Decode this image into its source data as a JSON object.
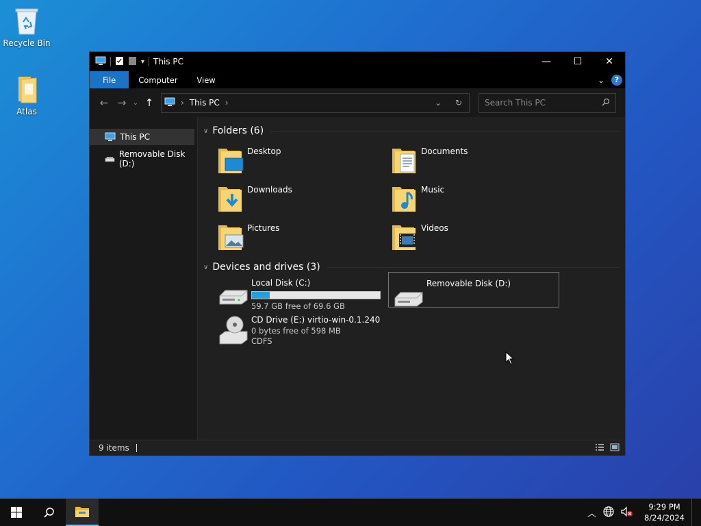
{
  "desktop": {
    "icons": [
      {
        "label": "Recycle Bin",
        "icon": "recycle-bin-icon"
      },
      {
        "label": "Atlas",
        "icon": "folder-icon"
      }
    ]
  },
  "window": {
    "title": "This PC",
    "controls": {
      "minimize": "—",
      "maximize": "☐",
      "close": "✕"
    },
    "ribbon": {
      "tabs": [
        "File",
        "Computer",
        "View"
      ],
      "help": "?"
    },
    "address": {
      "crumb": "This PC"
    },
    "search": {
      "placeholder": "Search This PC"
    },
    "sidebar": [
      {
        "label": "This PC",
        "icon": "computer-icon",
        "selected": true
      },
      {
        "label": "Removable Disk (D:)",
        "icon": "usb-drive-icon",
        "selected": false
      }
    ],
    "groups": {
      "folders": {
        "title": "Folders (6)"
      },
      "devices": {
        "title": "Devices and drives (3)"
      }
    },
    "folders": [
      {
        "name": "Desktop",
        "icon": "desktop-folder-icon"
      },
      {
        "name": "Documents",
        "icon": "documents-folder-icon"
      },
      {
        "name": "Downloads",
        "icon": "downloads-folder-icon"
      },
      {
        "name": "Music",
        "icon": "music-folder-icon"
      },
      {
        "name": "Pictures",
        "icon": "pictures-folder-icon"
      },
      {
        "name": "Videos",
        "icon": "videos-folder-icon"
      }
    ],
    "drives": [
      {
        "name": "Local Disk (C:)",
        "free": "59.7 GB free of 69.6 GB",
        "used_fraction": 0.14,
        "icon": "hard-drive-icon"
      },
      {
        "name": "CD Drive (E:) virtio-win-0.1.240",
        "free": "0 bytes free of 598 MB",
        "fs": "CDFS",
        "icon": "cd-drive-icon"
      },
      {
        "name": "Removable Disk (D:)",
        "icon": "removable-drive-icon",
        "selected": true
      }
    ],
    "status": {
      "items": "9 items"
    }
  },
  "taskbar": {
    "clock": {
      "time": "9:29 PM",
      "date": "8/24/2024"
    }
  },
  "colors": {
    "accent": "#1a73c5",
    "drive_bar": "#26a0da",
    "window_bg": "#202020"
  }
}
